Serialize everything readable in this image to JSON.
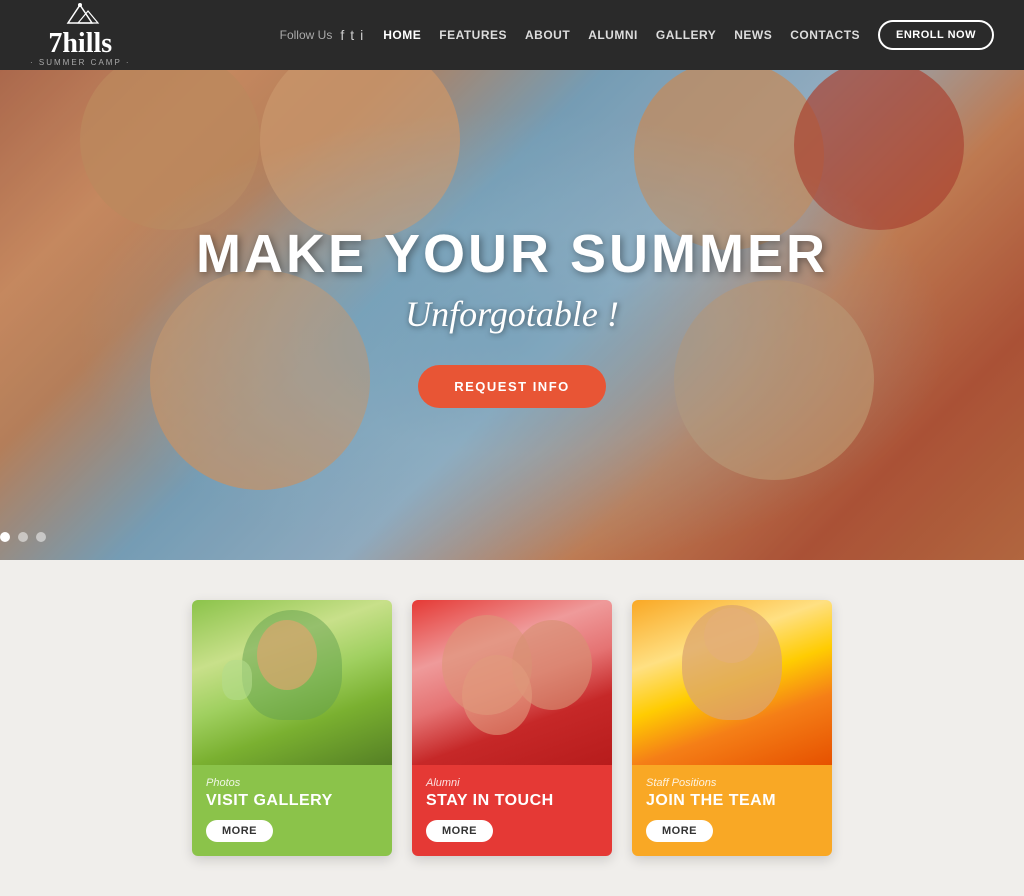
{
  "header": {
    "logo_text": "7hills",
    "logo_subtitle": "· SUMMER CAMP ·",
    "follow_us": "Follow Us",
    "nav_items": [
      {
        "label": "HOME",
        "active": true
      },
      {
        "label": "FEATURES",
        "active": false
      },
      {
        "label": "ABOUT",
        "active": false
      },
      {
        "label": "ALUMNI",
        "active": false
      },
      {
        "label": "GALLERY",
        "active": false
      },
      {
        "label": "NEWS",
        "active": false
      },
      {
        "label": "CONTACTS",
        "active": false
      }
    ],
    "enroll_button": "ENROLL NOW"
  },
  "hero": {
    "title": "MAKE YOUR SUMMER",
    "subtitle": "Unforgotable !",
    "cta_button": "REQUEST INFO"
  },
  "cards": [
    {
      "category": "Photos",
      "title": "VISIT GALLERY",
      "more": "MORE",
      "color": "green"
    },
    {
      "category": "Alumni",
      "title": "STAY IN TOUCH",
      "more": "MORE",
      "color": "red"
    },
    {
      "category": "Staff Positions",
      "title": "JOIN THE TEAM",
      "more": "MORE",
      "color": "yellow"
    }
  ],
  "social": {
    "facebook": "f",
    "twitter": "t",
    "instagram": "i"
  }
}
